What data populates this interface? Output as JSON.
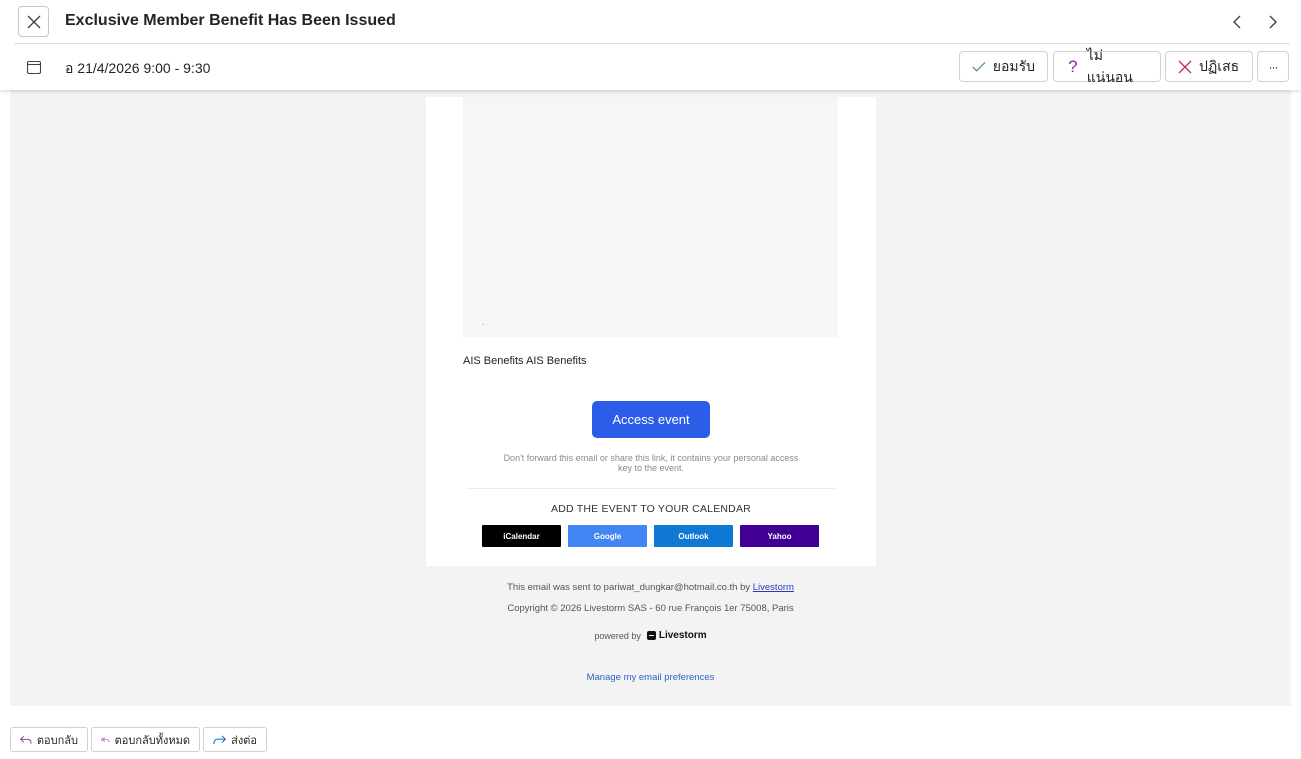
{
  "header": {
    "title": "Exclusive Member Benefit Has Been Issued"
  },
  "meeting": {
    "datetime": "อ 21/4/2026 9:00 - 9:30",
    "accept_label": "ยอมรับ",
    "tentative_label": "ไม่แน่นอน",
    "decline_label": "ปฏิเสธ",
    "more_label": "···"
  },
  "email": {
    "hero_dot": ".",
    "benefit_text": "AIS Benefits AIS Benefits",
    "access_button": "Access event",
    "warning_text": "Don't forward this email or share this link, it contains your personal access key to the event.",
    "calendar_heading": "ADD THE EVENT TO YOUR CALENDAR",
    "calendar_buttons": {
      "icalendar": "iCalendar",
      "google": "Google",
      "outlook": "Outlook",
      "yahoo": "Yahoo"
    },
    "footer": {
      "sent_to_prefix": "This email was sent to pariwat_dungkar@hotmail.co.th by ",
      "sent_by_link": "Livestorm",
      "copyright": "Copyright © 2026 Livestorm SAS - 60 rue François 1er 75008, Paris",
      "powered_by": "powered by",
      "powered_brand": "Livestorm",
      "preferences_link": "Manage my email preferences"
    }
  },
  "actions": {
    "reply": "ตอบกลับ",
    "reply_all": "ตอบกลับทั้งหมด",
    "forward": "ส่งต่อ"
  },
  "colors": {
    "access_button": "#2b5de8",
    "icalendar": "#000000",
    "google": "#4285f4",
    "outlook": "#0f78d4",
    "yahoo": "#410093",
    "accept_check": "#2f7d32",
    "tentative_mark": "#8a2a9c",
    "decline_x": "#c4314b",
    "reply_arrow": "#8a2a9c",
    "forward_arrow": "#0f6cbd"
  }
}
